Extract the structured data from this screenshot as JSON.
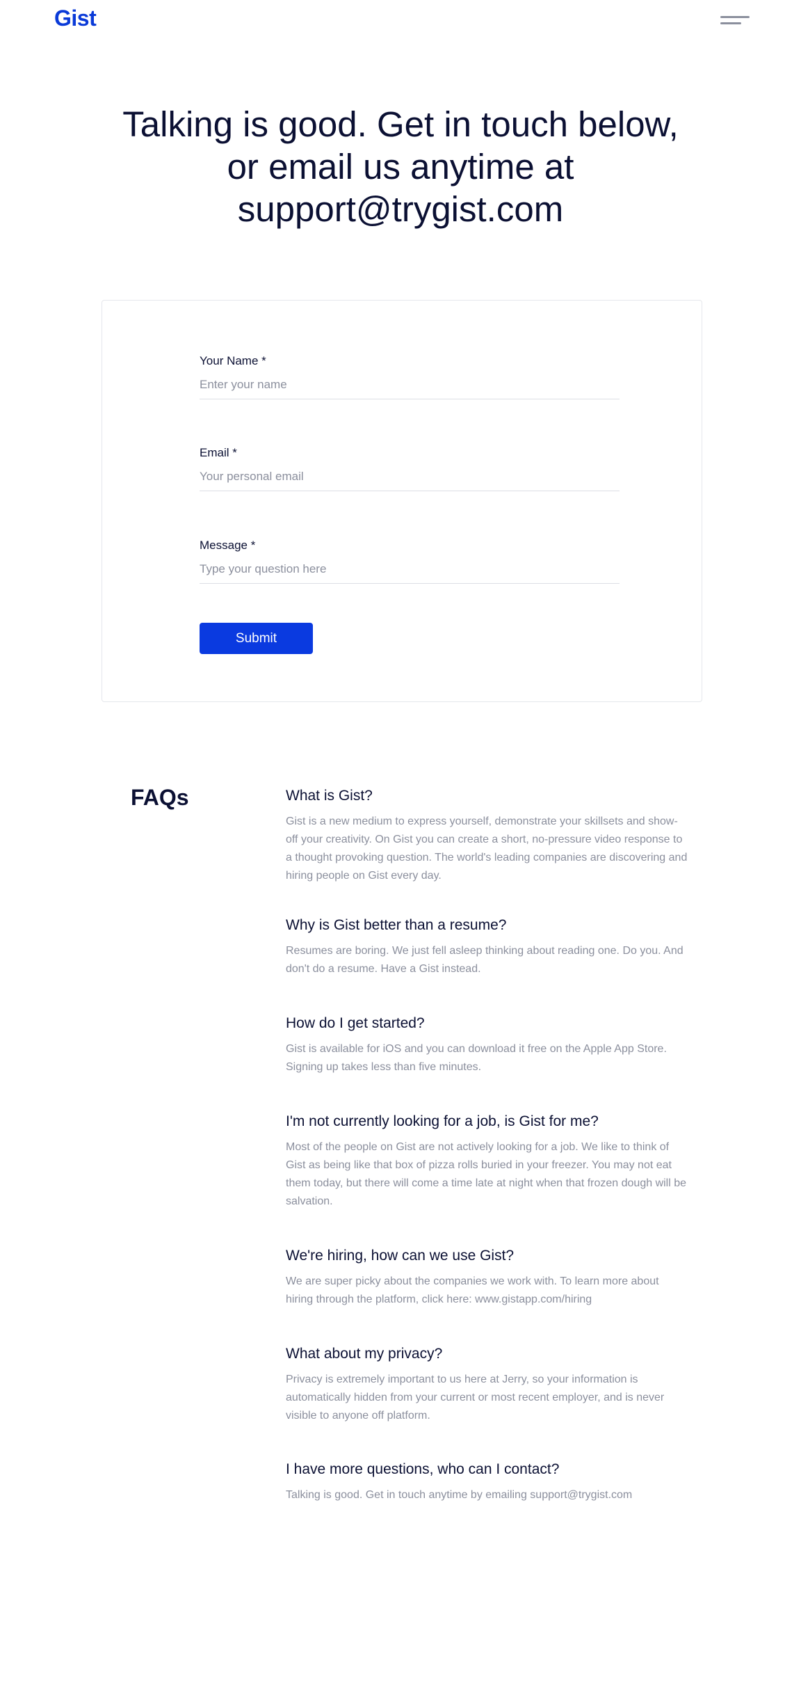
{
  "header": {
    "logo": "Gist"
  },
  "hero": {
    "text": "Talking is good. Get in touch below, or email us anytime at support@trygist.com"
  },
  "form": {
    "name": {
      "label": "Your Name *",
      "placeholder": "Enter your name",
      "value": ""
    },
    "email": {
      "label": "Email *",
      "placeholder": "Your personal email",
      "value": ""
    },
    "message": {
      "label": "Message *",
      "placeholder": "Type your question here",
      "value": ""
    },
    "submit_label": "Submit"
  },
  "faq": {
    "heading": "FAQs",
    "items": [
      {
        "question": "What is Gist?",
        "answer": "Gist is a new medium to express yourself, demonstrate your skillsets and show-off your creativity. On Gist you can create a short, no-pressure video response to a thought provoking question. The world's leading companies are discovering and hiring people on Gist every day."
      },
      {
        "question": "Why is Gist better than a resume?",
        "answer": "Resumes are boring. We just fell asleep thinking about reading one. Do you. And don't do a resume. Have a Gist instead."
      },
      {
        "question": "How do I get started?",
        "answer": "Gist is available for iOS and you can download it free on the Apple App Store. Signing up takes less than five minutes."
      },
      {
        "question": "I'm not currently looking for a job, is Gist for me?",
        "answer": "Most of the people on Gist are not actively looking for a job. We like to think of Gist as being like that box of pizza rolls buried in your freezer. You may not eat them today, but there will come a time late at night when that frozen dough will be salvation."
      },
      {
        "question": "We're hiring, how can we use Gist?",
        "answer": "We are super picky about the companies we work with. To learn more about hiring through the platform, click here: www.gistapp.com/hiring"
      },
      {
        "question": "What about my privacy?",
        "answer": "Privacy is extremely important to us here at Jerry, so your information  is automatically hidden from your current or most recent employer, and is never visible to anyone off platform."
      },
      {
        "question": "I have more questions, who can I contact?",
        "answer": "Talking is good. Get in touch anytime by emailing support@trygist.com"
      }
    ]
  }
}
